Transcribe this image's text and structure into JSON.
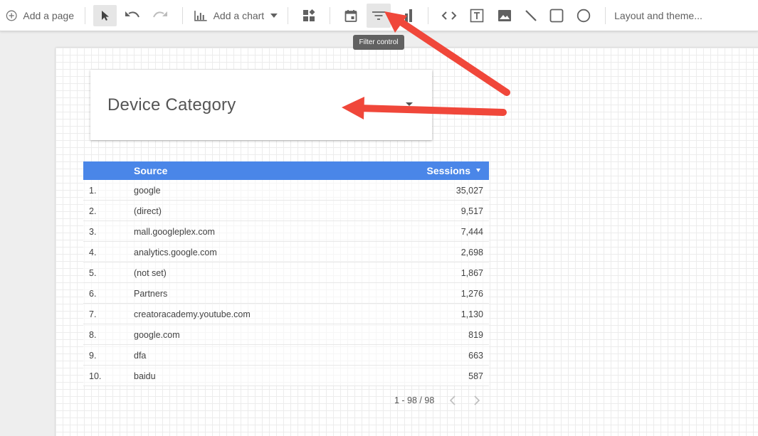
{
  "toolbar": {
    "add_page_label": "Add a page",
    "add_chart_label": "Add a chart",
    "layout_theme_label": "Layout and theme...",
    "tooltip": "Filter control"
  },
  "filter_control": {
    "title": "Device Category"
  },
  "table": {
    "columns": [
      "Source",
      "Sessions"
    ],
    "rows": [
      {
        "num": "1.",
        "source": "google",
        "sessions": "35,027"
      },
      {
        "num": "2.",
        "source": "(direct)",
        "sessions": "9,517"
      },
      {
        "num": "3.",
        "source": "mall.googleplex.com",
        "sessions": "7,444"
      },
      {
        "num": "4.",
        "source": "analytics.google.com",
        "sessions": "2,698"
      },
      {
        "num": "5.",
        "source": "(not set)",
        "sessions": "1,867"
      },
      {
        "num": "6.",
        "source": "Partners",
        "sessions": "1,276"
      },
      {
        "num": "7.",
        "source": "creatoracademy.youtube.com",
        "sessions": "1,130"
      },
      {
        "num": "8.",
        "source": "google.com",
        "sessions": "819"
      },
      {
        "num": "9.",
        "source": "dfa",
        "sessions": "663"
      },
      {
        "num": "10.",
        "source": "baidu",
        "sessions": "587"
      }
    ],
    "pagination": "1 - 98 / 98"
  },
  "colors": {
    "table_header": "#4a86e8",
    "annotation_arrow": "#f0473a"
  }
}
